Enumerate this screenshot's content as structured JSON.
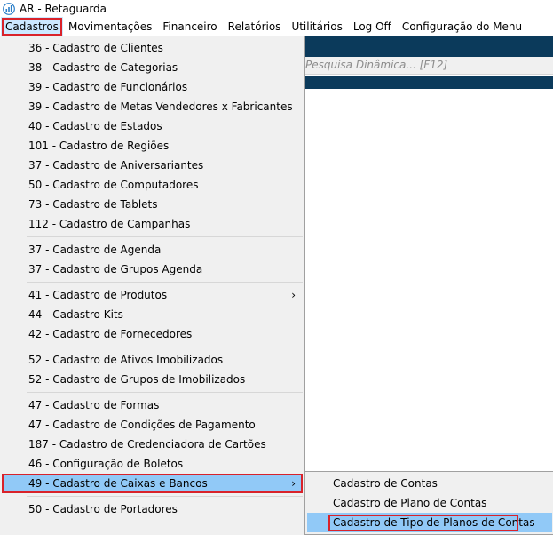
{
  "window": {
    "title": "AR - Retaguarda"
  },
  "menubar": [
    "Cadastros",
    "Movimentações",
    "Financeiro",
    "Relatórios",
    "Utilitários",
    "Log Off",
    "Configuração do Menu"
  ],
  "search": {
    "placeholder": "Pesquisa Dinâmica... [F12]"
  },
  "dropdown": {
    "items": [
      "36 - Cadastro de Clientes",
      "38 - Cadastro de Categorias",
      "39 - Cadastro de Funcionários",
      "39 - Cadastro de Metas Vendedores x Fabricantes",
      "40 - Cadastro de Estados",
      "101 - Cadastro de Regiões",
      "37 - Cadastro de Aniversariantes",
      "50 - Cadastro de Computadores",
      "73 - Cadastro de Tablets",
      "112 - Cadastro de Campanhas",
      "37 - Cadastro de Agenda",
      "37 - Cadastro de Grupos Agenda",
      "41 - Cadastro de Produtos",
      "44 - Cadastro Kits",
      "42 - Cadastro de Fornecedores",
      "52 - Cadastro de Ativos Imobilizados",
      "52 - Cadastro de Grupos de Imobilizados",
      "47 - Cadastro de Formas",
      "47 - Cadastro de Condições de Pagamento",
      "187 - Cadastro de Credenciadora de Cartões",
      "46 - Configuração de Boletos",
      "49 - Cadastro de Caixas e Bancos",
      "50 - Cadastro de Portadores"
    ]
  },
  "submenu": {
    "items": [
      "Cadastro de Contas",
      "Cadastro de Plano de Contas",
      "Cadastro de Tipo de Planos de Contas"
    ]
  },
  "colors": {
    "navy": "#0b3a5b",
    "highlight": "#91c9f7",
    "callout": "#d9222a"
  }
}
